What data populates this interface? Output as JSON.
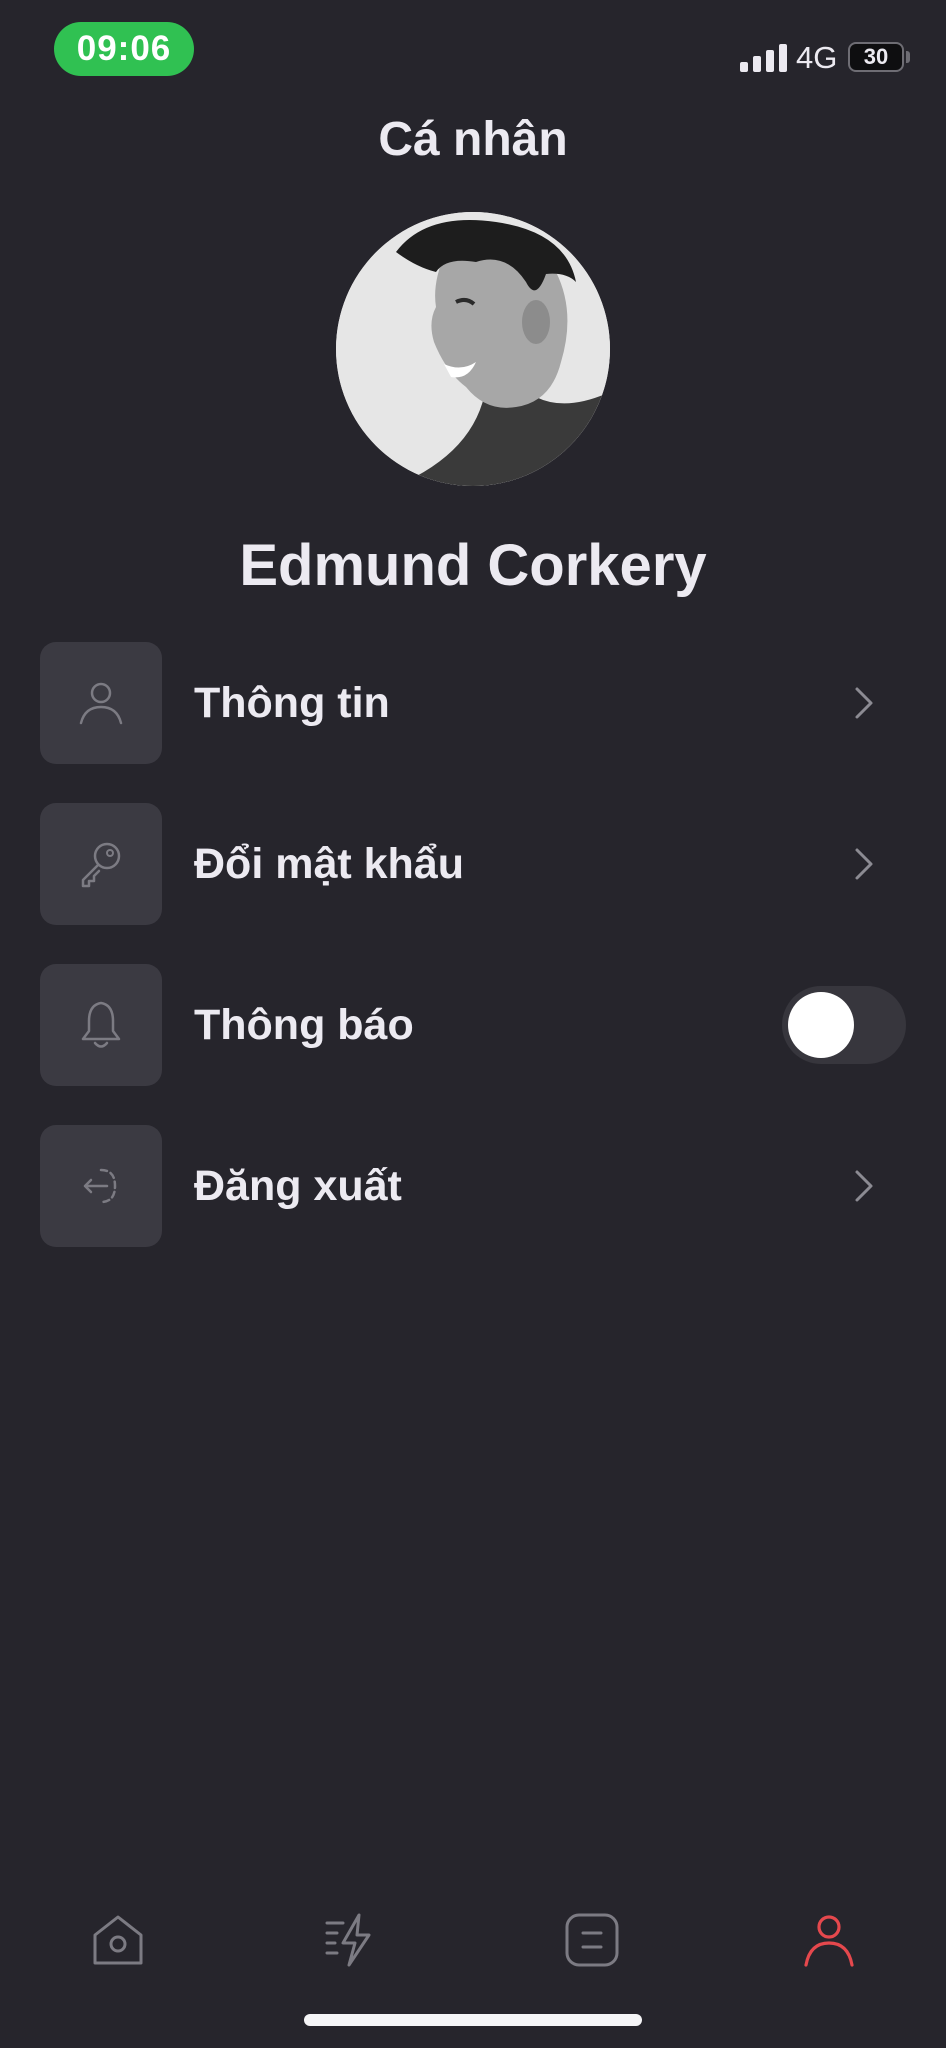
{
  "status_bar": {
    "time": "09:06",
    "network": "4G",
    "battery": "30"
  },
  "header": {
    "title": "Cá nhân"
  },
  "profile": {
    "name": "Edmund Corkery"
  },
  "menu": {
    "items": [
      {
        "label": "Thông tin",
        "icon": "user-icon"
      },
      {
        "label": "Đổi mật khẩu",
        "icon": "key-icon"
      },
      {
        "label": "Thông báo",
        "icon": "bell-icon",
        "toggle_on": false
      },
      {
        "label": "Đăng xuất",
        "icon": "logout-icon"
      }
    ]
  },
  "tab_bar": {
    "tabs": [
      {
        "icon": "home-icon",
        "active": false
      },
      {
        "icon": "lightning-icon",
        "active": false
      },
      {
        "icon": "list-icon",
        "active": false
      },
      {
        "icon": "profile-icon",
        "active": true
      }
    ]
  },
  "colors": {
    "background": "#26252c",
    "icon_box": "#3b3a42",
    "text": "#eceaf1",
    "accent_active": "#e5484d",
    "time_pill": "#30c152",
    "icon_muted": "#7c7b83"
  }
}
